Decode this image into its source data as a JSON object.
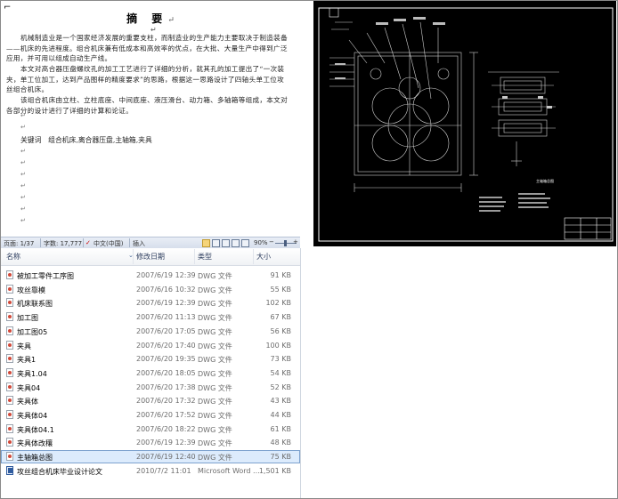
{
  "document": {
    "title": "摘 要",
    "para1": "机械制造业是一个国家经济发展的重要支柱，而制造业的生产能力主要取决于制造装备——机床的先进程度。组合机床兼有低成本和高效率的优点，在大批、大量生产中得到广泛应用，并可用以组成自动生产线。",
    "para2": "本文对高合器压盘螺纹孔的加工工艺进行了详细的分析，就其孔的加工提出了“一次装夹，单工位加工，达到产品图样的精度要求”的思路，根据这一思路设计了四轴头单工位攻丝组合机床。",
    "para3": "该组合机床由立柱、立柱底座、中间底座、液压滑台、动力箱、多轴箱等组成，本文对各部分的设计进行了详细的计算和论证。",
    "keywords": "关键词　组合机床,离合器压盘,主轴箱,夹具"
  },
  "statusbar": {
    "page": "页面: 1/37",
    "words": "字数: 17,777",
    "language": "中文(中国)",
    "mode": "插入",
    "zoom": "90%"
  },
  "explorer": {
    "columns": {
      "name": "名称",
      "date": "修改日期",
      "type": "类型",
      "size": "大小"
    },
    "files": [
      {
        "name": "被加工零件工序图",
        "date": "2007/6/19 12:39",
        "type": "DWG 文件",
        "size": "91 KB"
      },
      {
        "name": "攻丝靠模",
        "date": "2007/6/16 10:32",
        "type": "DWG 文件",
        "size": "55 KB"
      },
      {
        "name": "机床联系图",
        "date": "2007/6/19 12:39",
        "type": "DWG 文件",
        "size": "102 KB"
      },
      {
        "name": "加工图",
        "date": "2007/6/20 11:13",
        "type": "DWG 文件",
        "size": "67 KB"
      },
      {
        "name": "加工图05",
        "date": "2007/6/20 17:05",
        "type": "DWG 文件",
        "size": "56 KB"
      },
      {
        "name": "夹具",
        "date": "2007/6/20 17:40",
        "type": "DWG 文件",
        "size": "100 KB"
      },
      {
        "name": "夹具1",
        "date": "2007/6/20 19:35",
        "type": "DWG 文件",
        "size": "73 KB"
      },
      {
        "name": "夹具1.04",
        "date": "2007/6/20 18:05",
        "type": "DWG 文件",
        "size": "54 KB"
      },
      {
        "name": "夹具04",
        "date": "2007/6/20 17:38",
        "type": "DWG 文件",
        "size": "52 KB"
      },
      {
        "name": "夹具体",
        "date": "2007/6/20 17:32",
        "type": "DWG 文件",
        "size": "43 KB"
      },
      {
        "name": "夹具体04",
        "date": "2007/6/20 17:52",
        "type": "DWG 文件",
        "size": "44 KB"
      },
      {
        "name": "夹具体04.1",
        "date": "2007/6/20 18:22",
        "type": "DWG 文件",
        "size": "61 KB"
      },
      {
        "name": "夹具体改穰",
        "date": "2007/6/19 12:39",
        "type": "DWG 文件",
        "size": "48 KB"
      },
      {
        "name": "主轴箱总图",
        "date": "2007/6/19 12:40",
        "type": "DWG 文件",
        "size": "75 KB",
        "selected": true
      },
      {
        "name": "攻丝组合机床毕业设计论文",
        "date": "2010/7/2 11:01",
        "type": "Microsoft Word ...",
        "size": "1,501 KB",
        "word": true
      }
    ]
  },
  "cad": {
    "title_block_text": "主轴箱总图"
  }
}
